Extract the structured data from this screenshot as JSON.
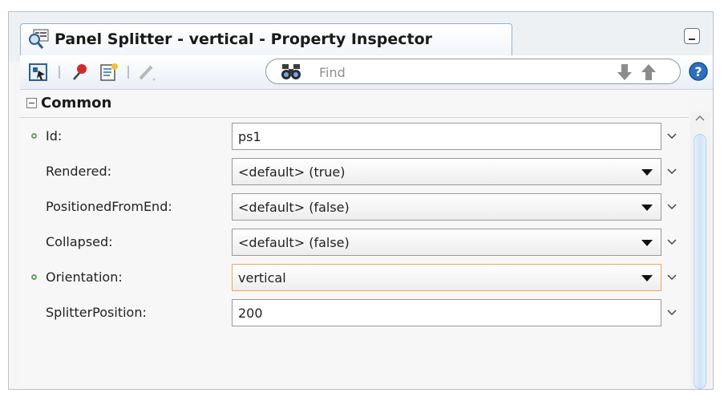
{
  "window": {
    "title": "Panel Splitter - vertical - Property Inspector"
  },
  "toolbar": {
    "icons": [
      "select-component-icon",
      "pin-icon",
      "edit-properties-icon",
      "pencil-icon"
    ],
    "search": {
      "placeholder": "Find",
      "value": ""
    },
    "nav_icons": [
      "arrow-down-icon",
      "arrow-up-icon"
    ],
    "help_icon": "help-icon"
  },
  "section": {
    "title": "Common",
    "rows": [
      {
        "label": "Id:",
        "value": "ps1",
        "type": "text",
        "required": true,
        "focused": false
      },
      {
        "label": "Rendered:",
        "value": "<default> (true)",
        "type": "select",
        "required": false,
        "focused": false
      },
      {
        "label": "PositionedFromEnd:",
        "value": "<default> (false)",
        "type": "select",
        "required": false,
        "focused": false
      },
      {
        "label": "Collapsed:",
        "value": "<default> (false)",
        "type": "select",
        "required": false,
        "focused": false
      },
      {
        "label": "Orientation:",
        "value": "vertical",
        "type": "select",
        "required": true,
        "focused": true
      },
      {
        "label": "SplitterPosition:",
        "value": "200",
        "type": "text",
        "required": false,
        "focused": false
      }
    ]
  },
  "colors": {
    "required_dot": "#62a35f",
    "focus_border": "#f0a35a",
    "tab_border": "#93b2d4",
    "help_blue": "#2a6fc2"
  }
}
